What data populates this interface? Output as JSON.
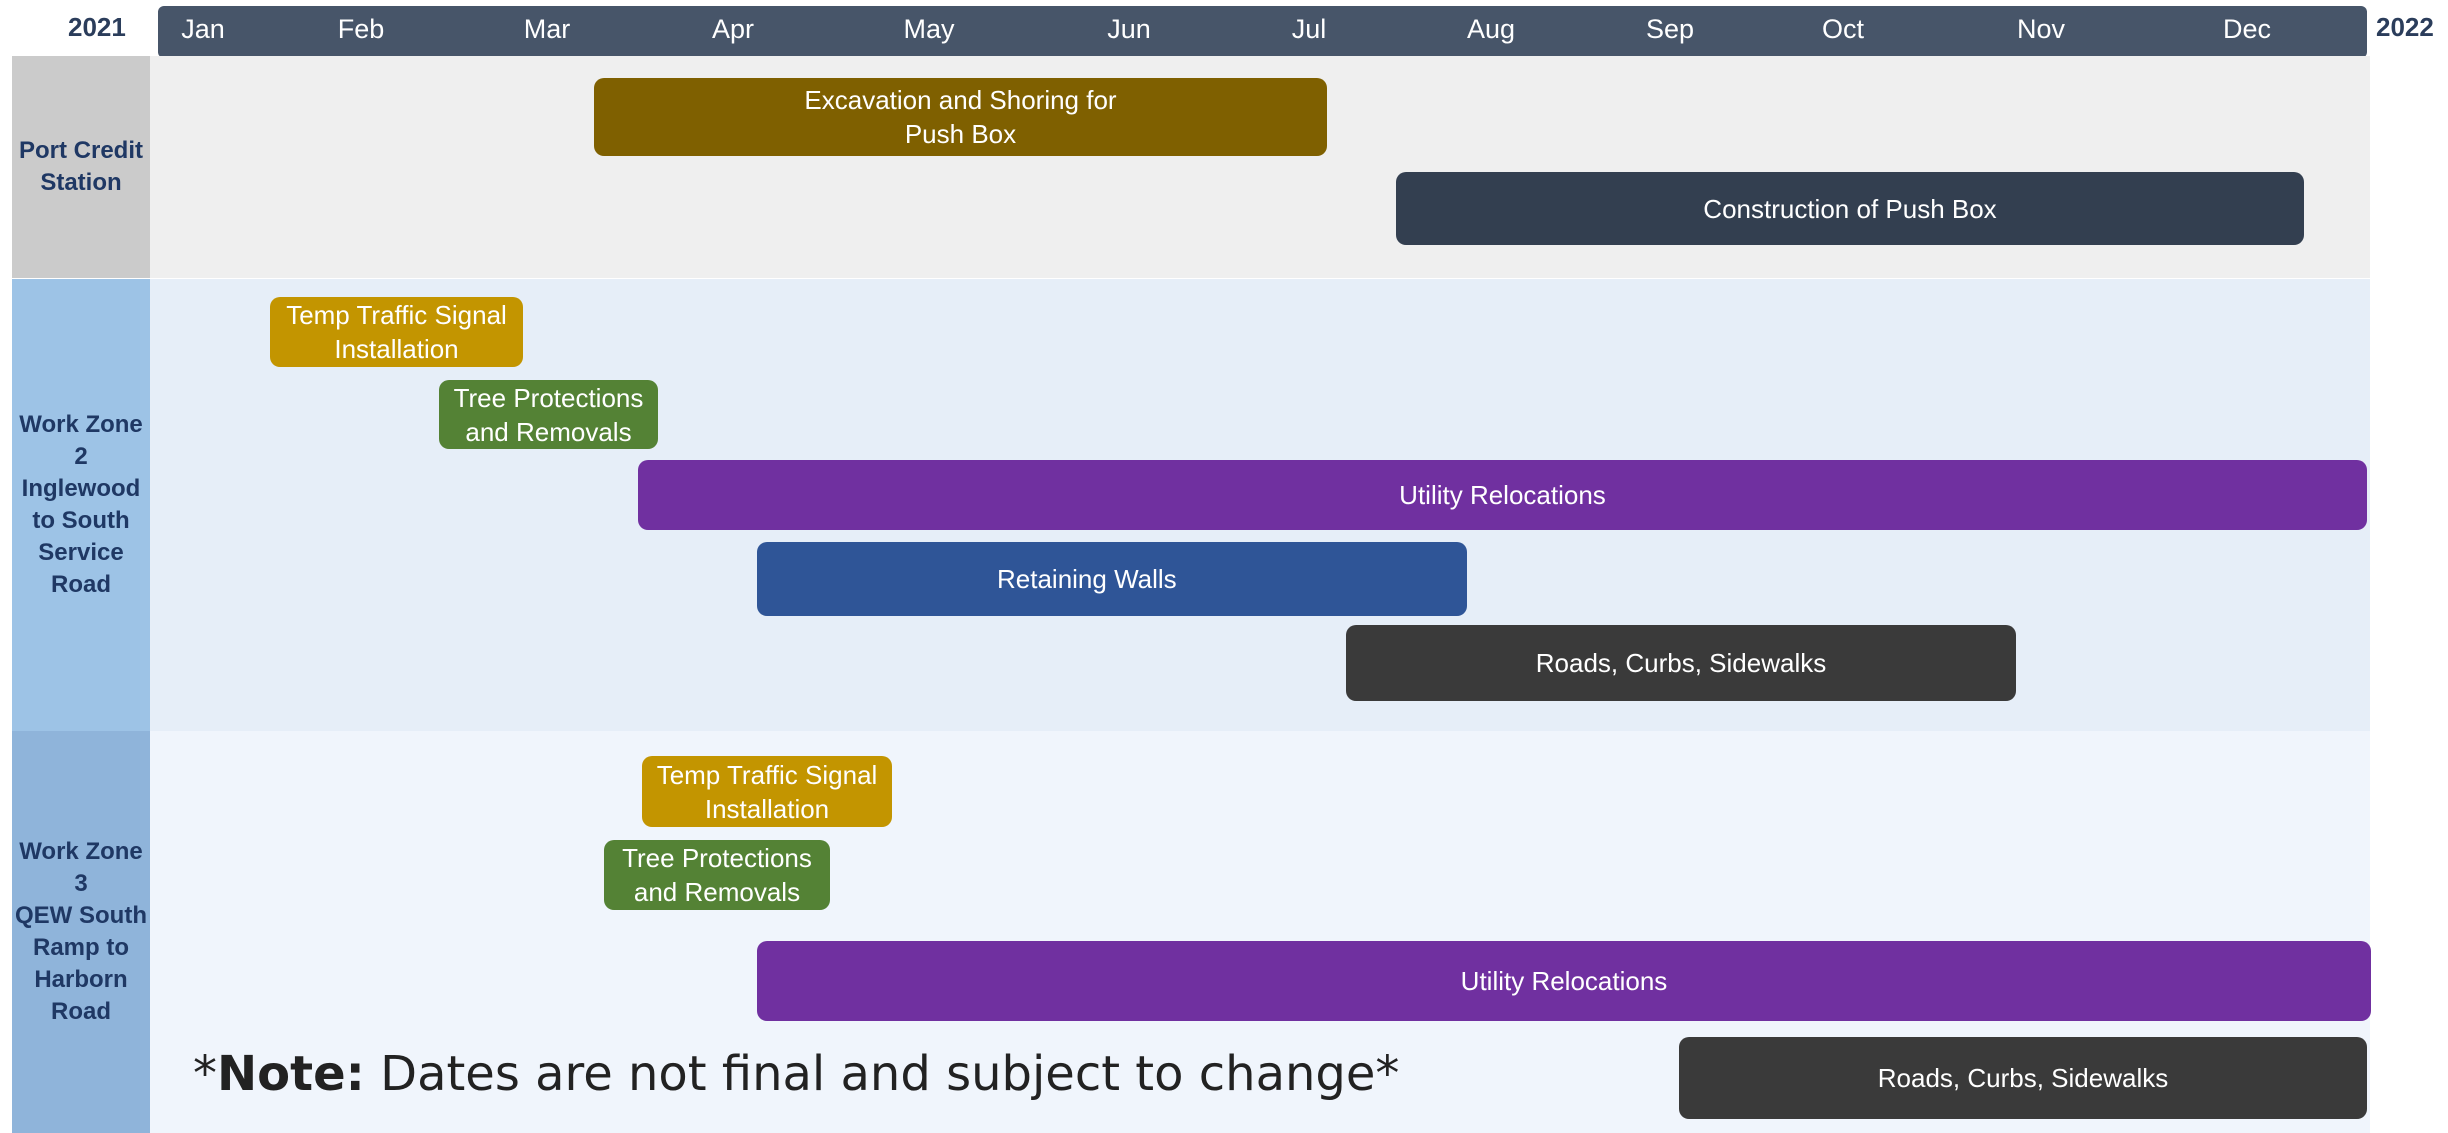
{
  "header": {
    "year_start": "2021",
    "year_end": "2022",
    "months": [
      "Jan",
      "Feb",
      "Mar",
      "Apr",
      "May",
      "Jun",
      "Jul",
      "Aug",
      "Sep",
      "Oct",
      "Nov",
      "Dec"
    ]
  },
  "lanes": [
    {
      "label": "Port Credit\nStation",
      "tasks": [
        {
          "label": "Excavation and Shoring for\nPush Box",
          "color": "#7f6000"
        },
        {
          "label": "Construction of Push Box",
          "color": "#333f50"
        }
      ]
    },
    {
      "label": "Work Zone\n2\nInglewood\nto South\nService\nRoad",
      "tasks": [
        {
          "label": "Temp Traffic Signal\nInstallation",
          "color": "#c39500"
        },
        {
          "label": "Tree Protections\nand Removals",
          "color": "#548235"
        },
        {
          "label": "Utility Relocations",
          "color": "#7030a0"
        },
        {
          "label": "Retaining Walls",
          "color": "#2f5597"
        },
        {
          "label": "Roads, Curbs, Sidewalks",
          "color": "#3a3a3a"
        }
      ]
    },
    {
      "label": "Work Zone\n3\nQEW South\nRamp to\nHarborn\nRoad",
      "tasks": [
        {
          "label": "Temp Traffic Signal\nInstallation",
          "color": "#c39500"
        },
        {
          "label": "Tree Protections\nand Removals",
          "color": "#548235"
        },
        {
          "label": "Utility Relocations",
          "color": "#7030a0"
        },
        {
          "label": "Roads, Curbs, Sidewalks",
          "color": "#3a3a3a"
        }
      ]
    }
  ],
  "note": {
    "prefix": "*",
    "bold": "Note:",
    "text": " Dates are not final and subject to change*"
  }
}
